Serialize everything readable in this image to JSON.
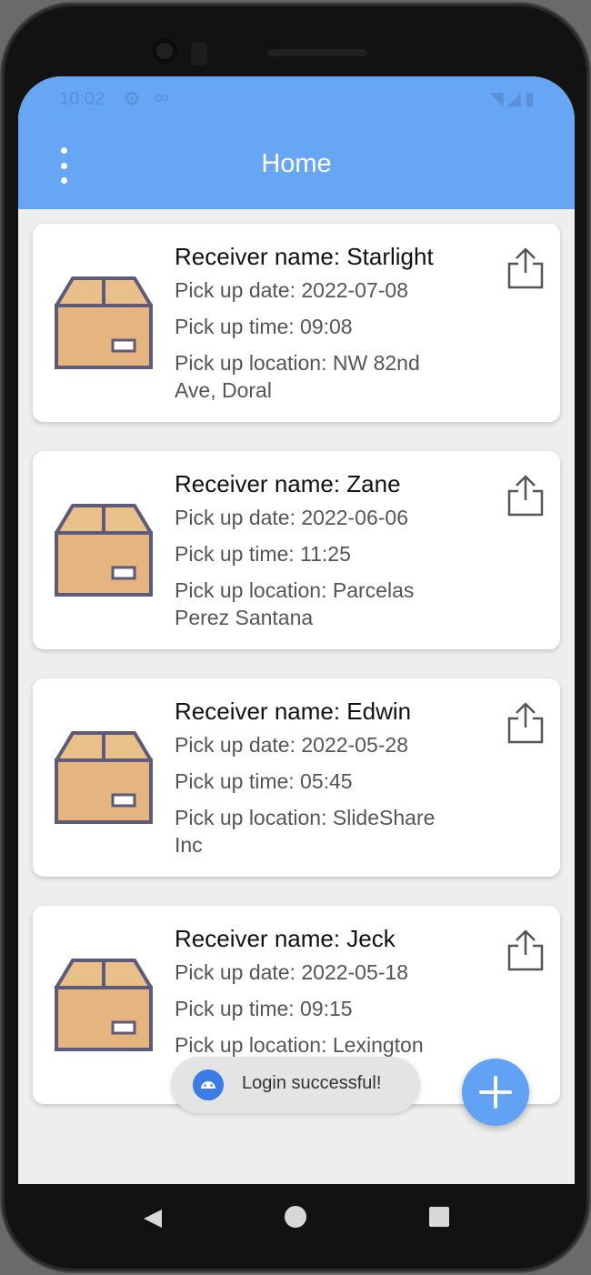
{
  "status_bar": {
    "time": "10:02",
    "icons": [
      "gear-icon",
      "more-icon",
      "wifi-icon",
      "signal-icon",
      "battery-icon"
    ]
  },
  "app_bar": {
    "title": "Home",
    "menu_icon": "more-vert-icon"
  },
  "colors": {
    "primary": "#66a6f5",
    "fab": "#62a2f4",
    "card_bg": "#ffffff",
    "screen_bg": "#eeeeee",
    "box_fill": "#eac08a",
    "box_stroke": "#5d5a7a"
  },
  "orders": [
    {
      "receiver": "Receiver name: Starlight",
      "date": "Pick up date: 2022-07-08",
      "time": "Pick up time: 09:08",
      "location_1": "Pick up location: NW 82nd",
      "location_2": "Ave, Doral"
    },
    {
      "receiver": "Receiver name: Zane",
      "date": "Pick up date: 2022-06-06",
      "time": "Pick up time: 11:25",
      "location_1": "Pick up location: Parcelas",
      "location_2": "Perez Santana"
    },
    {
      "receiver": "Receiver name: Edwin",
      "date": "Pick up date: 2022-05-28",
      "time": "Pick up time: 05:45",
      "location_1": "Pick up location: SlideShare",
      "location_2": "Inc"
    },
    {
      "receiver": "Receiver name: Jeck",
      "date": "Pick up date: 2022-05-18",
      "time": "Pick up time: 09:15",
      "location_1": "Pick up location: Lexington",
      "location_2": ""
    }
  ],
  "toast": {
    "message": "Login successful!",
    "icon": "android-icon"
  },
  "fab": {
    "icon": "plus-icon"
  },
  "nav": {
    "icons": [
      "back-icon",
      "home-icon",
      "recents-icon"
    ]
  }
}
